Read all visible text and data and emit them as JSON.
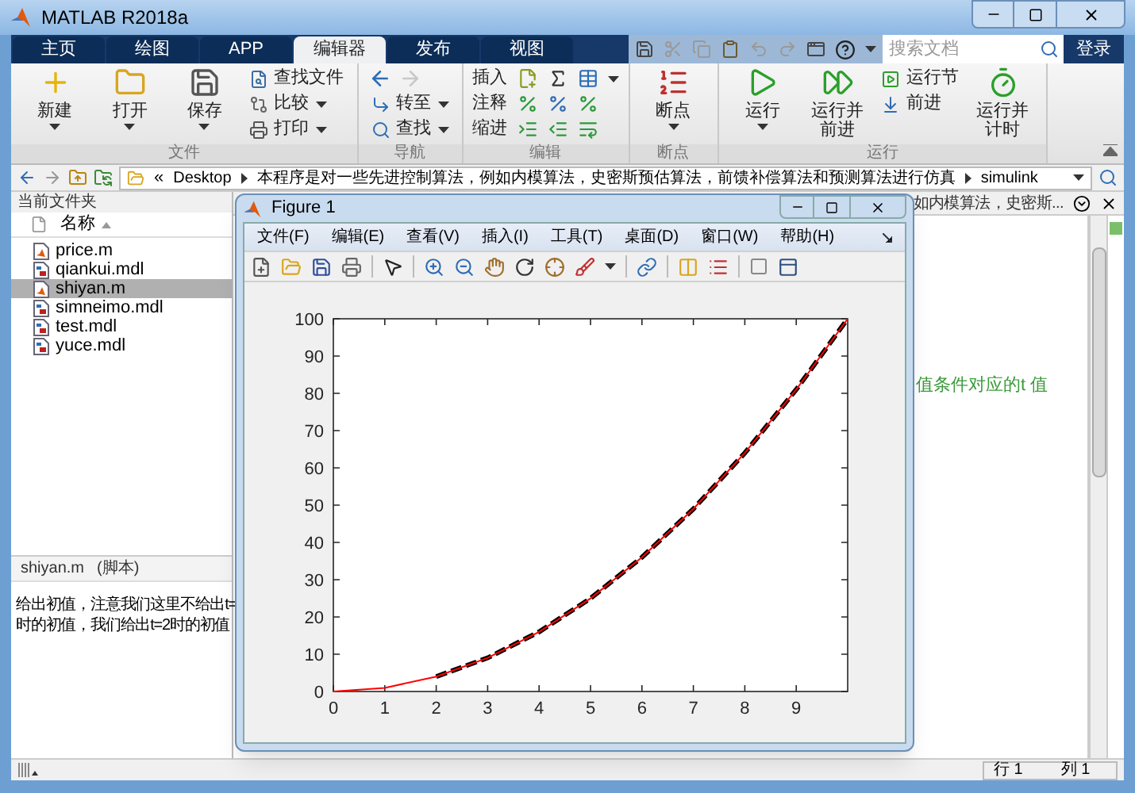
{
  "window": {
    "title": "MATLAB R2018a"
  },
  "tabs": [
    {
      "label": "主页",
      "selected": false
    },
    {
      "label": "绘图",
      "selected": false
    },
    {
      "label": "APP",
      "selected": false
    },
    {
      "label": "编辑器",
      "selected": true
    },
    {
      "label": "发布",
      "selected": false
    },
    {
      "label": "视图",
      "selected": false
    }
  ],
  "search": {
    "placeholder": "搜索文档"
  },
  "login": "登录",
  "ribbon": [
    {
      "label": "文件",
      "items": [
        {
          "kind": "large",
          "label": "新建",
          "dropdown": true
        },
        {
          "kind": "large",
          "label": "打开",
          "dropdown": true
        },
        {
          "kind": "large",
          "label": "保存",
          "dropdown": true
        },
        {
          "kind": "small",
          "label": "查找文件",
          "dropdown": false
        },
        {
          "kind": "small",
          "label": "比较",
          "dropdown": true
        },
        {
          "kind": "small",
          "label": "打印",
          "dropdown": true
        }
      ]
    },
    {
      "label": "导航",
      "items": [
        {
          "kind": "icon-row",
          "forward_disabled": true
        },
        {
          "kind": "small",
          "label": "转至",
          "dropdown": true
        },
        {
          "kind": "small",
          "label": "查找",
          "dropdown": true
        }
      ]
    },
    {
      "label": "编辑",
      "items": [
        {
          "kind": "edit-row",
          "label": "插入",
          "dropdown": true
        },
        {
          "kind": "edit-row",
          "label": "注释",
          "dropdown": false
        },
        {
          "kind": "edit-row",
          "label": "缩进",
          "dropdown": false
        }
      ]
    },
    {
      "label": "断点",
      "items": [
        {
          "kind": "large",
          "label": "断点",
          "dropdown": true
        }
      ]
    },
    {
      "label": "运行",
      "items": [
        {
          "kind": "large",
          "label": "运行",
          "dropdown": true
        },
        {
          "kind": "large",
          "label": "运行并前进",
          "dropdown": false
        },
        {
          "kind": "small",
          "label": "运行节",
          "dropdown": false
        },
        {
          "kind": "small",
          "label": "前进",
          "dropdown": false
        },
        {
          "kind": "large",
          "label": "运行并计时",
          "dropdown": false
        }
      ]
    }
  ],
  "address": {
    "prefix": "«",
    "parts": [
      "Desktop",
      "本程序是对一些先进控制算法，例如内模算法，史密斯预估算法，前馈补偿算法和预测算法进行仿真",
      "simulink"
    ]
  },
  "file_browser": {
    "title": "当前文件夹",
    "column": "名称",
    "files": [
      {
        "name": "price.m",
        "kind": "m",
        "selected": false
      },
      {
        "name": "qiankui.mdl",
        "kind": "mdl",
        "selected": false
      },
      {
        "name": "shiyan.m",
        "kind": "m",
        "selected": true
      },
      {
        "name": "simneimo.mdl",
        "kind": "mdl",
        "selected": false
      },
      {
        "name": "test.mdl",
        "kind": "mdl",
        "selected": false
      },
      {
        "name": "yuce.mdl",
        "kind": "mdl",
        "selected": false
      }
    ]
  },
  "details": {
    "title": "shiyan.m",
    "type": "(脚本)",
    "lines": [
      "给出初值，注意我们这里不给出t=",
      "时的初值，我们给出t=2时的初值"
    ]
  },
  "editor": {
    "tab_title": "如内模算法，史密斯...",
    "comment": "值条件对应的t 值"
  },
  "status": {
    "row": "行 1",
    "col": "列 1"
  },
  "figure": {
    "title": "Figure 1",
    "menus": [
      "文件(F)",
      "编辑(E)",
      "查看(V)",
      "插入(I)",
      "工具(T)",
      "桌面(D)",
      "窗口(W)",
      "帮助(H)"
    ],
    "chart_data": {
      "type": "line",
      "x": [
        0,
        1,
        2,
        3,
        4,
        5,
        6,
        7,
        8,
        9,
        10
      ],
      "series": [
        {
          "color": "#ff0000",
          "line_style": "solid",
          "values": [
            0,
            1,
            4,
            9,
            16,
            25,
            36,
            49,
            64,
            81,
            100
          ]
        },
        {
          "color": "#000000",
          "line_style": "dashed",
          "values": [
            null,
            null,
            4,
            9,
            16,
            25,
            36,
            49,
            64,
            81,
            100
          ]
        }
      ],
      "xlim": [
        0,
        10
      ],
      "ylim": [
        0,
        100
      ],
      "xticks": [
        0,
        1,
        2,
        3,
        4,
        5,
        6,
        7,
        8,
        9
      ],
      "yticks": [
        0,
        10,
        20,
        30,
        40,
        50,
        60,
        70,
        80,
        90,
        100
      ]
    }
  }
}
